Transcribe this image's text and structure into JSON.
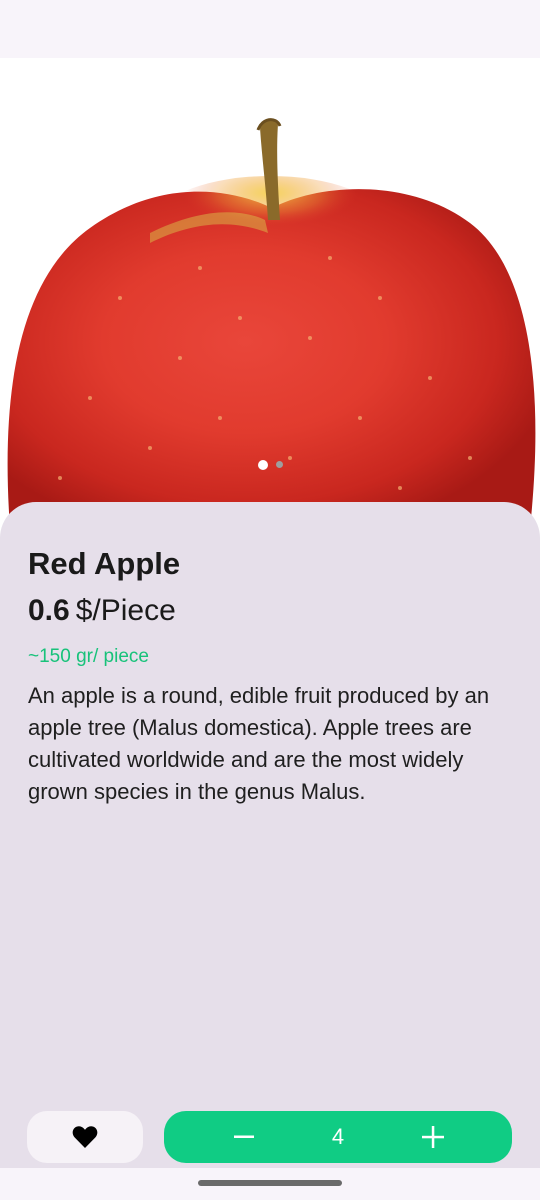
{
  "product": {
    "name": "Red Apple",
    "price_value": "0.6",
    "price_unit": "$/Piece",
    "weight_note": "~150 gr/ piece",
    "description": "An apple is a round, edible fruit produced by an apple tree (Malus domestica). Apple trees are cultivated worldwide and are the most widely grown species in the genus Malus."
  },
  "gallery": {
    "pages": 2,
    "current_page": 1
  },
  "actions": {
    "favorite_icon": "heart-icon",
    "decrement_icon": "minus-icon",
    "increment_icon": "plus-icon",
    "quantity": "4"
  },
  "colors": {
    "accent": "#10cc84",
    "weight_text": "#18c27a",
    "sheet_background": "#e6dfea"
  }
}
